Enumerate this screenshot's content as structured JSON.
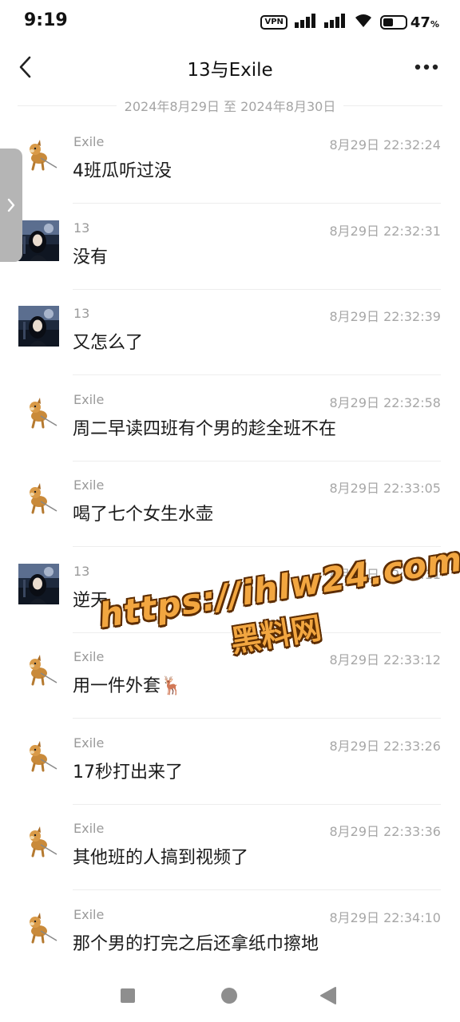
{
  "status_bar": {
    "time": "9:19",
    "vpn_label": "VPN",
    "battery_percent": 47,
    "battery_text": "47",
    "battery_unit": "%"
  },
  "header": {
    "title": "13与Exile",
    "back_icon": "chevron-left-icon",
    "more_icon": "more-horizontal-icon"
  },
  "date_range": "2024年8月29日 至 2024年8月30日",
  "side_tab_icon": "chevron-right-icon",
  "messages": [
    {
      "sender": "Exile",
      "time": "8月29日 22:32:24",
      "text": "4班瓜听过没",
      "avatar": "dog-avatar"
    },
    {
      "sender": "13",
      "time": "8月29日 22:32:31",
      "text": "没有",
      "avatar": "girl-photo-avatar"
    },
    {
      "sender": "13",
      "time": "8月29日 22:32:39",
      "text": "又怎么了",
      "avatar": "girl-photo-avatar"
    },
    {
      "sender": "Exile",
      "time": "8月29日 22:32:58",
      "text": "周二早读四班有个男的趁全班不在",
      "avatar": "dog-avatar"
    },
    {
      "sender": "Exile",
      "time": "8月29日 22:33:05",
      "text": "喝了七个女生水壶",
      "avatar": "dog-avatar"
    },
    {
      "sender": "13",
      "time": "8月29日 22:33:11",
      "text": "逆天",
      "avatar": "girl-photo-avatar"
    },
    {
      "sender": "Exile",
      "time": "8月29日 22:33:12",
      "text": "用一件外套🦌",
      "avatar": "dog-avatar"
    },
    {
      "sender": "Exile",
      "time": "8月29日 22:33:26",
      "text": "17秒打出来了",
      "avatar": "dog-avatar"
    },
    {
      "sender": "Exile",
      "time": "8月29日 22:33:36",
      "text": "其他班的人搞到视频了",
      "avatar": "dog-avatar"
    },
    {
      "sender": "Exile",
      "time": "8月29日 22:34:10",
      "text": "那个男的打完之后还拿纸巾擦地",
      "avatar": "dog-avatar"
    }
  ],
  "watermark": {
    "url": "https://ihlw24.com",
    "name": "黑料网"
  },
  "nav_bar": {
    "recents_icon": "square-icon",
    "home_icon": "circle-icon",
    "back_icon": "triangle-back-icon"
  },
  "colors": {
    "accent_watermark": "#f2a640",
    "watermark_outline": "#5c2c00",
    "meta_text": "#a7a7a7",
    "divider": "#ededed",
    "side_tab": "#b5b5b5"
  }
}
